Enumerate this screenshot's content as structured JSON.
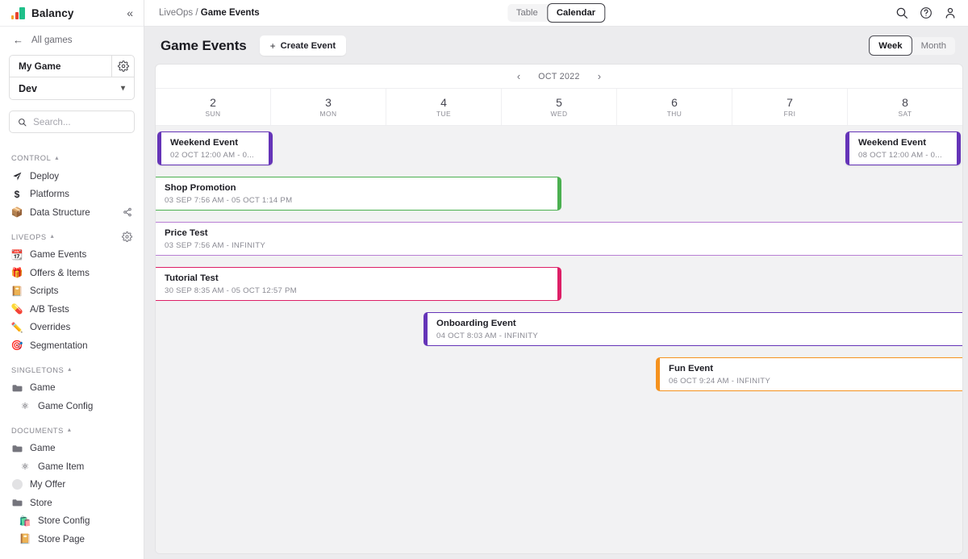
{
  "sidebar": {
    "logo_text": "Balancy",
    "collapse_icon": "chevron-double-left-icon",
    "all_games_label": "All games",
    "game_name": "My Game",
    "environment": "Dev",
    "search_placeholder": "Search...",
    "sections": [
      {
        "title": "CONTROL",
        "items": [
          {
            "label": "Deploy",
            "icon": "paper-plane-icon",
            "glyph": "➤",
            "indent": false,
            "action": null
          },
          {
            "label": "Platforms",
            "icon": "dollar-icon",
            "glyph": "$",
            "indent": false,
            "action": null
          },
          {
            "label": "Data Structure",
            "icon": "box-icon",
            "glyph": "📦",
            "indent": false,
            "action": "share-icon"
          }
        ],
        "action": null
      },
      {
        "title": "LIVEOPS",
        "action": "gear-icon",
        "items": [
          {
            "label": "Game Events",
            "icon": "calendar-edit-icon",
            "glyph": "📆",
            "indent": false,
            "action": null
          },
          {
            "label": "Offers & Items",
            "icon": "gift-icon",
            "glyph": "🎁",
            "indent": false,
            "action": null
          },
          {
            "label": "Scripts",
            "icon": "scroll-icon",
            "glyph": "📔",
            "indent": false,
            "action": null
          },
          {
            "label": "A/B Tests",
            "icon": "pill-icon",
            "glyph": "💊",
            "indent": false,
            "action": null
          },
          {
            "label": "Overrides",
            "icon": "pencil-icon",
            "glyph": "✏️",
            "indent": false,
            "action": null
          },
          {
            "label": "Segmentation",
            "icon": "target-icon",
            "glyph": "🎯",
            "indent": false,
            "action": null
          }
        ]
      },
      {
        "title": "SINGLETONS",
        "action": null,
        "items": [
          {
            "label": "Game",
            "icon": "folder-icon",
            "glyph": "▬",
            "indent": false,
            "action": null
          },
          {
            "label": "Game Config",
            "icon": "molecule-icon",
            "glyph": "⚛",
            "indent": true,
            "action": null
          }
        ]
      },
      {
        "title": "DOCUMENTS",
        "action": null,
        "items": [
          {
            "label": "Game",
            "icon": "folder-icon",
            "glyph": "▬",
            "indent": false,
            "action": null
          },
          {
            "label": "Game Item",
            "icon": "molecule-icon",
            "glyph": "⚛",
            "indent": true,
            "action": null
          },
          {
            "label": "My Offer",
            "icon": "circle-placeholder-icon",
            "glyph": "",
            "indent": false,
            "action": null
          },
          {
            "label": "Store",
            "icon": "folder-icon",
            "glyph": "▬",
            "indent": false,
            "action": null
          },
          {
            "label": "Store Config",
            "icon": "shopping-bag-icon",
            "glyph": "🛍️",
            "indent": true,
            "action": null
          },
          {
            "label": "Store Page",
            "icon": "scroll-icon",
            "glyph": "📔",
            "indent": true,
            "action": null
          }
        ]
      }
    ]
  },
  "topbar": {
    "breadcrumb_root": "LiveOps",
    "breadcrumb_sep": "/",
    "breadcrumb_current": "Game Events",
    "view_tabs": [
      {
        "label": "Table",
        "active": false
      },
      {
        "label": "Calendar",
        "active": true
      }
    ],
    "icons": [
      "search-icon",
      "help-icon",
      "user-icon"
    ]
  },
  "page": {
    "title": "Game Events",
    "create_button": "Create Event",
    "create_button_plus": "+",
    "range_tabs": [
      {
        "label": "Week",
        "active": true
      },
      {
        "label": "Month",
        "active": false
      }
    ]
  },
  "calendar": {
    "month_label": "OCT 2022",
    "prev_icon": "chevron-left-icon",
    "next_icon": "chevron-right-icon",
    "days": [
      {
        "num": "2",
        "name": "SUN"
      },
      {
        "num": "3",
        "name": "MON"
      },
      {
        "num": "4",
        "name": "TUE"
      },
      {
        "num": "5",
        "name": "WED"
      },
      {
        "num": "6",
        "name": "THU"
      },
      {
        "num": "7",
        "name": "FRI"
      },
      {
        "num": "8",
        "name": "SAT"
      }
    ],
    "events": [
      {
        "title": "Weekend Event",
        "time": "02 OCT 12:00 AM - 0...",
        "color": "#6534b8",
        "caps": "both",
        "left_pct": 0.2,
        "width_pct": 14.3,
        "row": 0
      },
      {
        "title": "Weekend Event",
        "time": "08 OCT 12:00 AM - 0...",
        "color": "#6534b8",
        "caps": "both",
        "left_pct": 85.5,
        "width_pct": 14.3,
        "row": 0
      },
      {
        "title": "Shop Promotion",
        "time": "03 SEP 7:56 AM - 05 OCT 1:14 PM",
        "color": "#4bb050",
        "caps": "right",
        "left_pct": 0,
        "width_pct": 50.3,
        "row": 1
      },
      {
        "title": "Price Test",
        "time": "03 SEP 7:56 AM - INFINITY",
        "color": "#b87fd4",
        "caps": "none",
        "left_pct": 0,
        "width_pct": 100,
        "row": 2
      },
      {
        "title": "Tutorial Test",
        "time": "30 SEP 8:35 AM - 05 OCT 12:57 PM",
        "color": "#dd1f66",
        "caps": "right",
        "left_pct": 0,
        "width_pct": 50.3,
        "row": 3
      },
      {
        "title": "Onboarding Event",
        "time": "04 OCT 8:03 AM - INFINITY",
        "color": "#6534b8",
        "caps": "left",
        "left_pct": 33.2,
        "width_pct": 66.8,
        "row": 4
      },
      {
        "title": "Fun Event",
        "time": "06 OCT 9:24 AM - INFINITY",
        "color": "#f5921e",
        "caps": "left",
        "left_pct": 62.0,
        "width_pct": 38.0,
        "row": 5
      }
    ]
  }
}
